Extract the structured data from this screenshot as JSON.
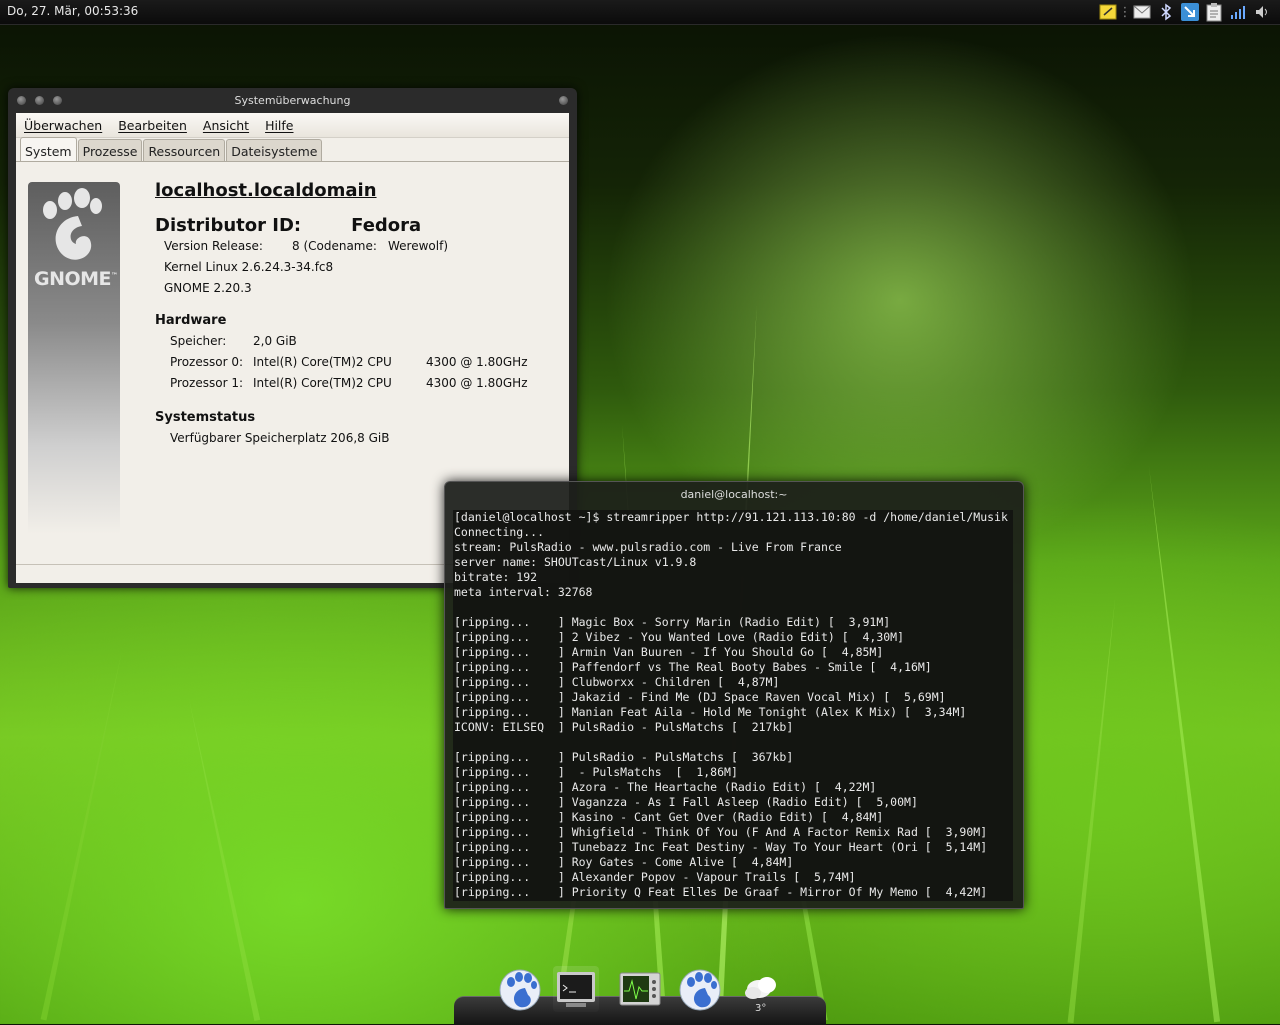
{
  "top_panel": {
    "clock": "Do, 27. Mär, 00:53:36",
    "tray_icons": [
      "notes-icon",
      "mail-icon",
      "bluetooth-icon",
      "network-icon",
      "clipboard-icon",
      "signal-icon",
      "volume-icon"
    ]
  },
  "system_monitor": {
    "title": "Systemüberwachung",
    "menu": [
      "Überwachen",
      "Bearbeiten",
      "Ansicht",
      "Hilfe"
    ],
    "tabs": [
      "System",
      "Prozesse",
      "Ressourcen",
      "Dateisysteme"
    ],
    "active_tab": "System",
    "logo_text": "GNOME",
    "logo_tm": "™",
    "hostname": "localhost.localdomain",
    "distributor_label": "Distributor ID:",
    "distributor_value": "Fedora",
    "version_label": "Version Release:",
    "version_value": "8 (Codename:",
    "codename_value": "Werewolf)",
    "kernel": "Kernel Linux 2.6.24.3-34.fc8",
    "gnome": "GNOME 2.20.3",
    "hardware_header": "Hardware",
    "memory_label": "Speicher:",
    "memory_value": "2,0 GiB",
    "cpu0_label": "Prozessor 0:",
    "cpu0_value": "Intel(R) Core(TM)2 CPU",
    "cpu0_speed": "4300  @ 1.80GHz",
    "cpu1_label": "Prozessor 1:",
    "cpu1_value": "Intel(R) Core(TM)2 CPU",
    "cpu1_speed": "4300  @ 1.80GHz",
    "status_header": "Systemstatus",
    "disk_label": "Verfügbarer Speicherplatz",
    "disk_value": "206,8 GiB"
  },
  "terminal": {
    "title": "daniel@localhost:~",
    "lines": [
      "[daniel@localhost ~]$ streamripper http://91.121.113.10:80 -d /home/daniel/Musik",
      "Connecting...",
      "stream: PulsRadio - www.pulsradio.com - Live From France",
      "server name: SHOUTcast/Linux v1.9.8",
      "bitrate: 192",
      "meta interval: 32768",
      "",
      "[ripping...    ] Magic Box - Sorry Marin (Radio Edit) [  3,91M]",
      "[ripping...    ] 2 Vibez - You Wanted Love (Radio Edit) [  4,30M]",
      "[ripping...    ] Armin Van Buuren - If You Should Go [  4,85M]",
      "[ripping...    ] Paffendorf vs The Real Booty Babes - Smile [  4,16M]",
      "[ripping...    ] Clubworxx - Children [  4,87M]",
      "[ripping...    ] Jakazid - Find Me (DJ Space Raven Vocal Mix) [  5,69M]",
      "[ripping...    ] Manian Feat Aila - Hold Me Tonight (Alex K Mix) [  3,34M]",
      "ICONV: EILSEQ  ] PulsRadio - PulsMatchs [  217kb]",
      "",
      "[ripping...    ] PulsRadio - PulsMatchs [  367kb]",
      "[ripping...    ]  - PulsMatchs  [  1,86M]",
      "[ripping...    ] Azora - The Heartache (Radio Edit) [  4,22M]",
      "[ripping...    ] Vaganzza - As I Fall Asleep (Radio Edit) [  5,00M]",
      "[ripping...    ] Kasino - Cant Get Over (Radio Edit) [  4,84M]",
      "[ripping...    ] Whigfield - Think Of You (F And A Factor Remix Rad [  3,90M]",
      "[ripping...    ] Tunebazz Inc Feat Destiny - Way To Your Heart (Ori [  5,14M]",
      "[ripping...    ] Roy Gates - Come Alive [  4,84M]",
      "[ripping...    ] Alexander Popov - Vapour Trails [  5,74M]",
      "[ripping...    ] Priority Q Feat Elles De Graaf - Mirror Of My Memo [  4,42M]"
    ]
  },
  "dock": {
    "items": [
      "gnome-foot-icon",
      "terminal-icon",
      "system-monitor-icon",
      "gnome-foot-icon",
      "weather-icon"
    ],
    "weather_temp": "3°"
  }
}
